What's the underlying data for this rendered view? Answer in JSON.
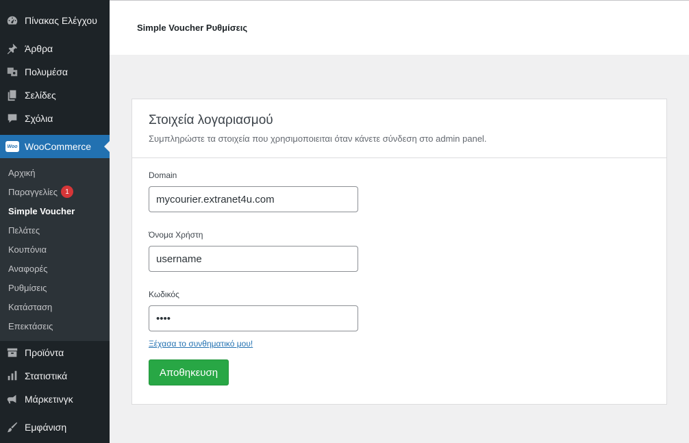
{
  "sidebar": {
    "dashboard": "Πίνακας Ελέγχου",
    "posts": "Άρθρα",
    "media": "Πολυμέσα",
    "pages": "Σελίδες",
    "comments": "Σχόλια",
    "woocommerce": "WooCommerce",
    "woo_badge": "Woo",
    "sub": {
      "home": "Αρχική",
      "orders": "Παραγγελίες",
      "orders_count": "1",
      "simple_voucher": "Simple Voucher",
      "customers": "Πελάτες",
      "coupons": "Κουπόνια",
      "reports": "Αναφορές",
      "settings": "Ρυθμίσεις",
      "status": "Κατάσταση",
      "extensions": "Επεκτάσεις"
    },
    "products": "Προϊόντα",
    "analytics": "Στατιστικά",
    "marketing": "Μάρκετινγκ",
    "appearance": "Εμφάνιση"
  },
  "header": {
    "title": "Simple Voucher Ρυθμίσεις"
  },
  "card": {
    "title": "Στοιχεία λογαριασμού",
    "description": "Συμπληρώστε τα στοιχεία που χρησιμοποιειται όταν κάνετε σύνδεση στο admin panel.",
    "domain_label": "Domain",
    "domain_value": "mycourier.extranet4u.com",
    "username_label": "Όνομα Χρήστη",
    "username_value": "username",
    "password_label": "Κωδικός",
    "password_value": "••••",
    "forgot_link": "Ξέχασα το συνθηματικό μου!",
    "save_label": "Αποθηκευση"
  },
  "colors": {
    "accent": "#2271b1",
    "save": "#28a745",
    "badge": "#d63638",
    "sidebar_bg": "#1d2327"
  }
}
